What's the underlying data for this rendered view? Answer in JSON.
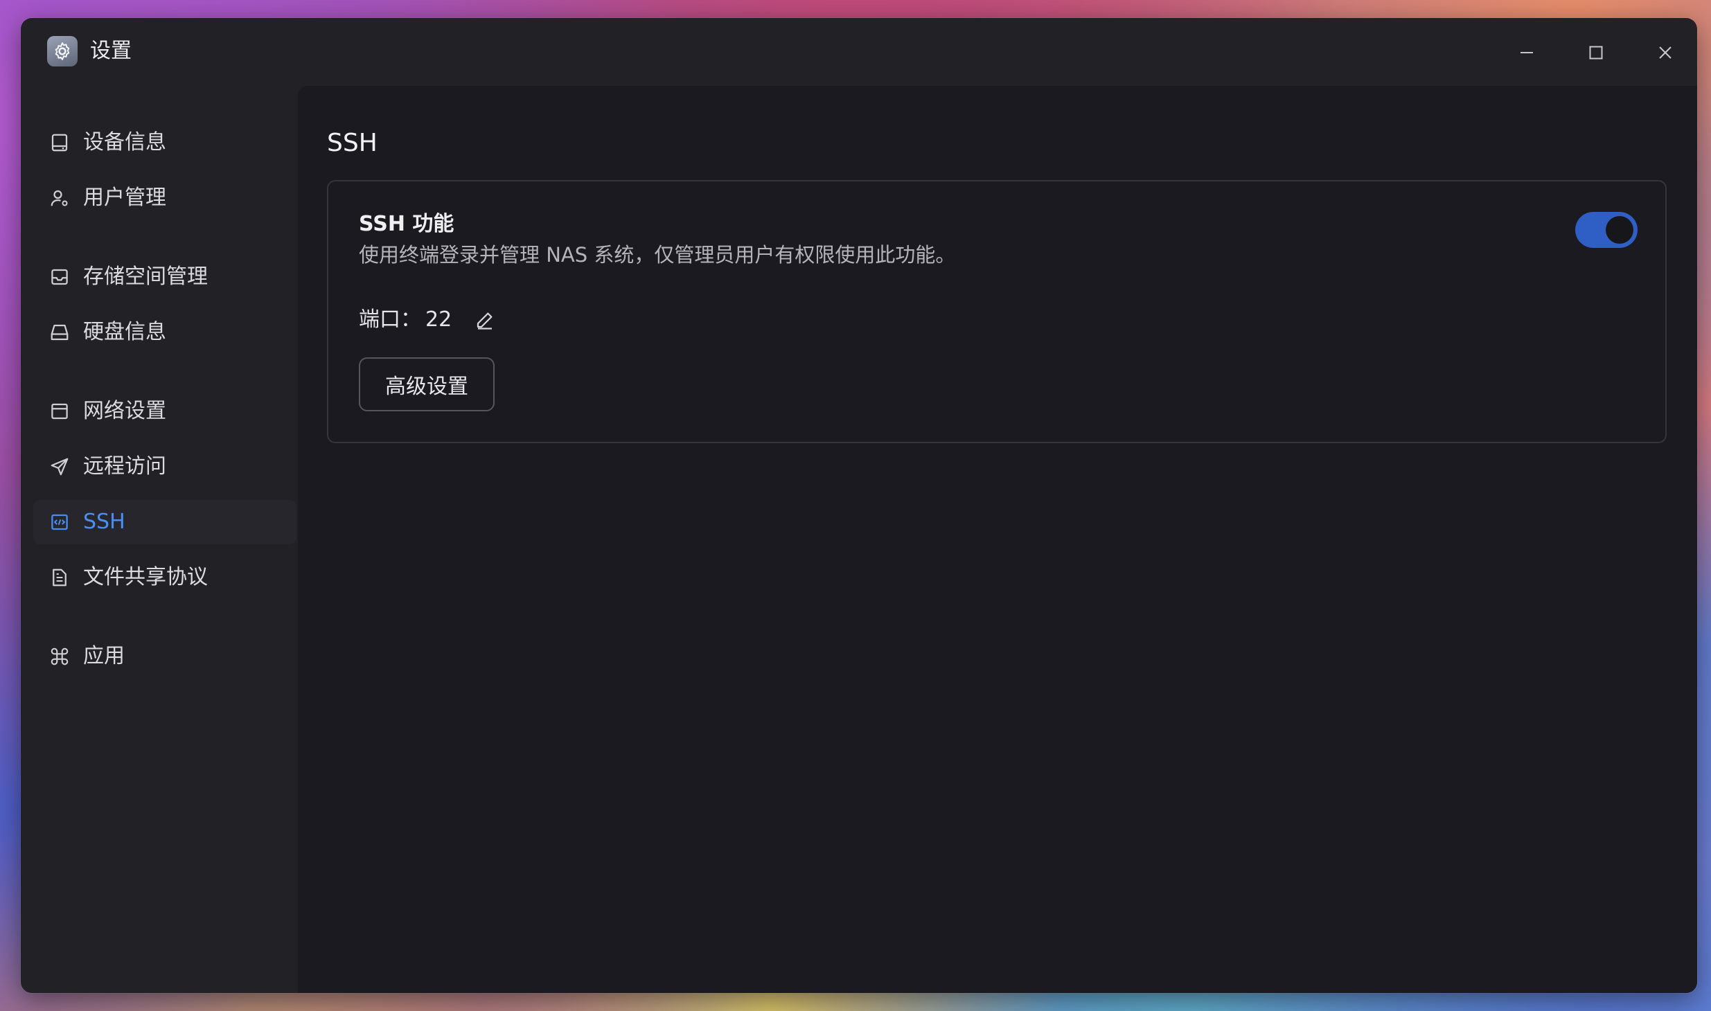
{
  "window": {
    "title": "设置",
    "app_icon": "gear-icon",
    "controls": [
      "minimize-icon",
      "maximize-icon",
      "close-icon"
    ]
  },
  "sidebar": {
    "items": [
      {
        "label": "设备信息",
        "icon": "device-icon"
      },
      {
        "label": "用户管理",
        "icon": "user-gear-icon"
      },
      {
        "label": "存储空间管理",
        "icon": "inbox-icon"
      },
      {
        "label": "硬盘信息",
        "icon": "drive-icon"
      },
      {
        "label": "网络设置",
        "icon": "window-icon"
      },
      {
        "label": "远程访问",
        "icon": "send-icon"
      },
      {
        "label": "SSH",
        "icon": "code-icon",
        "active": true
      },
      {
        "label": "文件共享协议",
        "icon": "document-icon"
      },
      {
        "label": "应用",
        "icon": "command-icon"
      }
    ]
  },
  "main": {
    "page_title": "SSH",
    "card": {
      "title": "SSH 功能",
      "description": "使用终端登录并管理 NAS 系统，仅管理员用户有权限使用此功能。",
      "toggle_on": true,
      "port_label": "端口：",
      "port_value": "22",
      "advanced_button": "高级设置"
    }
  },
  "colors": {
    "accent": "#4a8ff0",
    "toggle": "#2f5fc4",
    "window_bg": "#212126",
    "content_bg": "#1b1a20"
  }
}
